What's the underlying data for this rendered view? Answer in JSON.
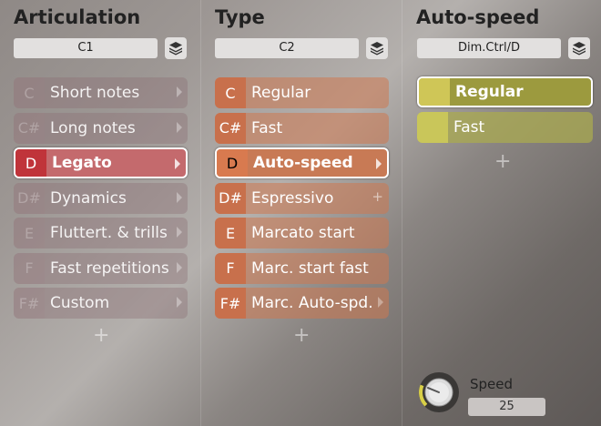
{
  "columns": [
    {
      "title": "Articulation",
      "selector": "C1",
      "items": [
        {
          "key": "C",
          "label": "Short notes"
        },
        {
          "key": "C#",
          "label": "Long notes"
        },
        {
          "key": "D",
          "label": "Legato"
        },
        {
          "key": "D#",
          "label": "Dynamics"
        },
        {
          "key": "E",
          "label": "Fluttert. & trills"
        },
        {
          "key": "F",
          "label": "Fast repetitions"
        },
        {
          "key": "F#",
          "label": "Custom"
        }
      ],
      "selected_index": 2
    },
    {
      "title": "Type",
      "selector": "C2",
      "items": [
        {
          "key": "C",
          "label": "Regular"
        },
        {
          "key": "C#",
          "label": "Fast"
        },
        {
          "key": "D",
          "label": "Auto-speed"
        },
        {
          "key": "D#",
          "label": "Espressivo"
        },
        {
          "key": "E",
          "label": "Marcato start"
        },
        {
          "key": "F",
          "label": "Marc. start fast"
        },
        {
          "key": "F#",
          "label": "Marc. Auto-spd."
        }
      ],
      "selected_index": 2
    },
    {
      "title": "Auto-speed",
      "selector": "Dim.Ctrl/D",
      "items": [
        {
          "key": "",
          "label": "Regular"
        },
        {
          "key": "",
          "label": "Fast"
        }
      ],
      "selected_index": 0
    }
  ],
  "add_symbol": "+",
  "speed": {
    "label": "Speed",
    "value": "25",
    "knob_fraction": 0.25
  },
  "colors": {
    "articulation_selected": "#c0343a",
    "type_key": "#c8704c",
    "autospeed_key": "#c9c65a"
  },
  "icons": {
    "layers": "layers-icon",
    "arrow": "chevron-right-icon",
    "add": "plus-icon",
    "knob": "knob-icon"
  }
}
